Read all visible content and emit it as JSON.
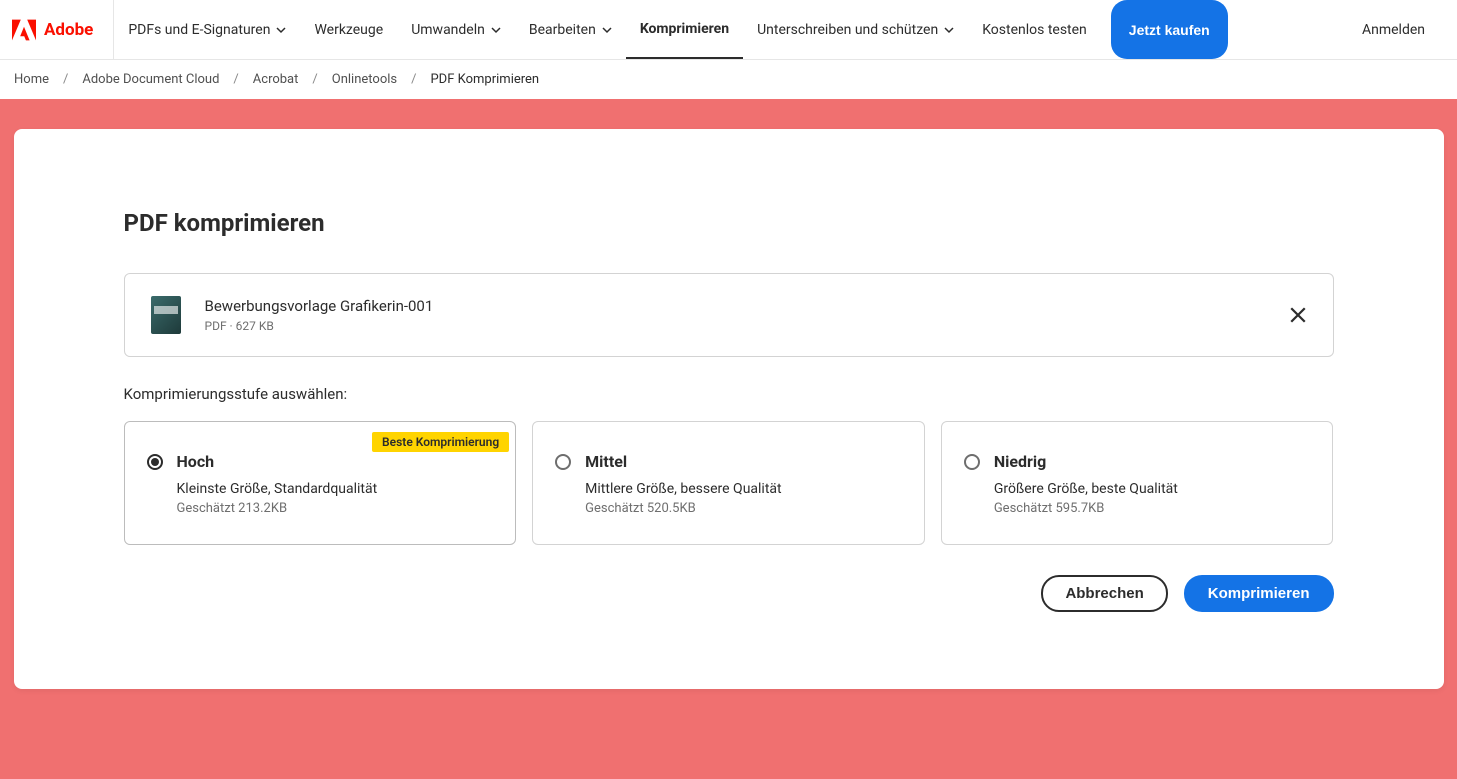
{
  "brand": "Adobe",
  "nav": {
    "items": [
      {
        "label": "PDFs und E-Signaturen",
        "dropdown": true,
        "active": false
      },
      {
        "label": "Werkzeuge",
        "dropdown": false,
        "active": false
      },
      {
        "label": "Umwandeln",
        "dropdown": true,
        "active": false
      },
      {
        "label": "Bearbeiten",
        "dropdown": true,
        "active": false
      },
      {
        "label": "Komprimieren",
        "dropdown": false,
        "active": true
      },
      {
        "label": "Unterschreiben und schützen",
        "dropdown": true,
        "active": false
      },
      {
        "label": "Kostenlos testen",
        "dropdown": false,
        "active": false
      }
    ],
    "buy_label": "Jetzt kaufen",
    "login_label": "Anmelden"
  },
  "breadcrumb": {
    "items": [
      "Home",
      "Adobe Document Cloud",
      "Acrobat",
      "Onlinetools"
    ],
    "current": "PDF Komprimieren"
  },
  "main": {
    "title": "PDF komprimieren",
    "file": {
      "name": "Bewerbungsvorlage Grafikerin-001",
      "meta": "PDF · 627 KB"
    },
    "level_label": "Komprimierungsstufe auswählen:",
    "badge": "Beste Komprimierung",
    "options": [
      {
        "title": "Hoch",
        "desc": "Kleinste Größe, Standardqualität",
        "est": "Geschätzt 213.2KB",
        "selected": true
      },
      {
        "title": "Mittel",
        "desc": "Mittlere Größe, bessere Qualität",
        "est": "Geschätzt 520.5KB",
        "selected": false
      },
      {
        "title": "Niedrig",
        "desc": "Größere Größe, beste Qualität",
        "est": "Geschätzt 595.7KB",
        "selected": false
      }
    ],
    "cancel_label": "Abbrechen",
    "compress_label": "Komprimieren"
  }
}
